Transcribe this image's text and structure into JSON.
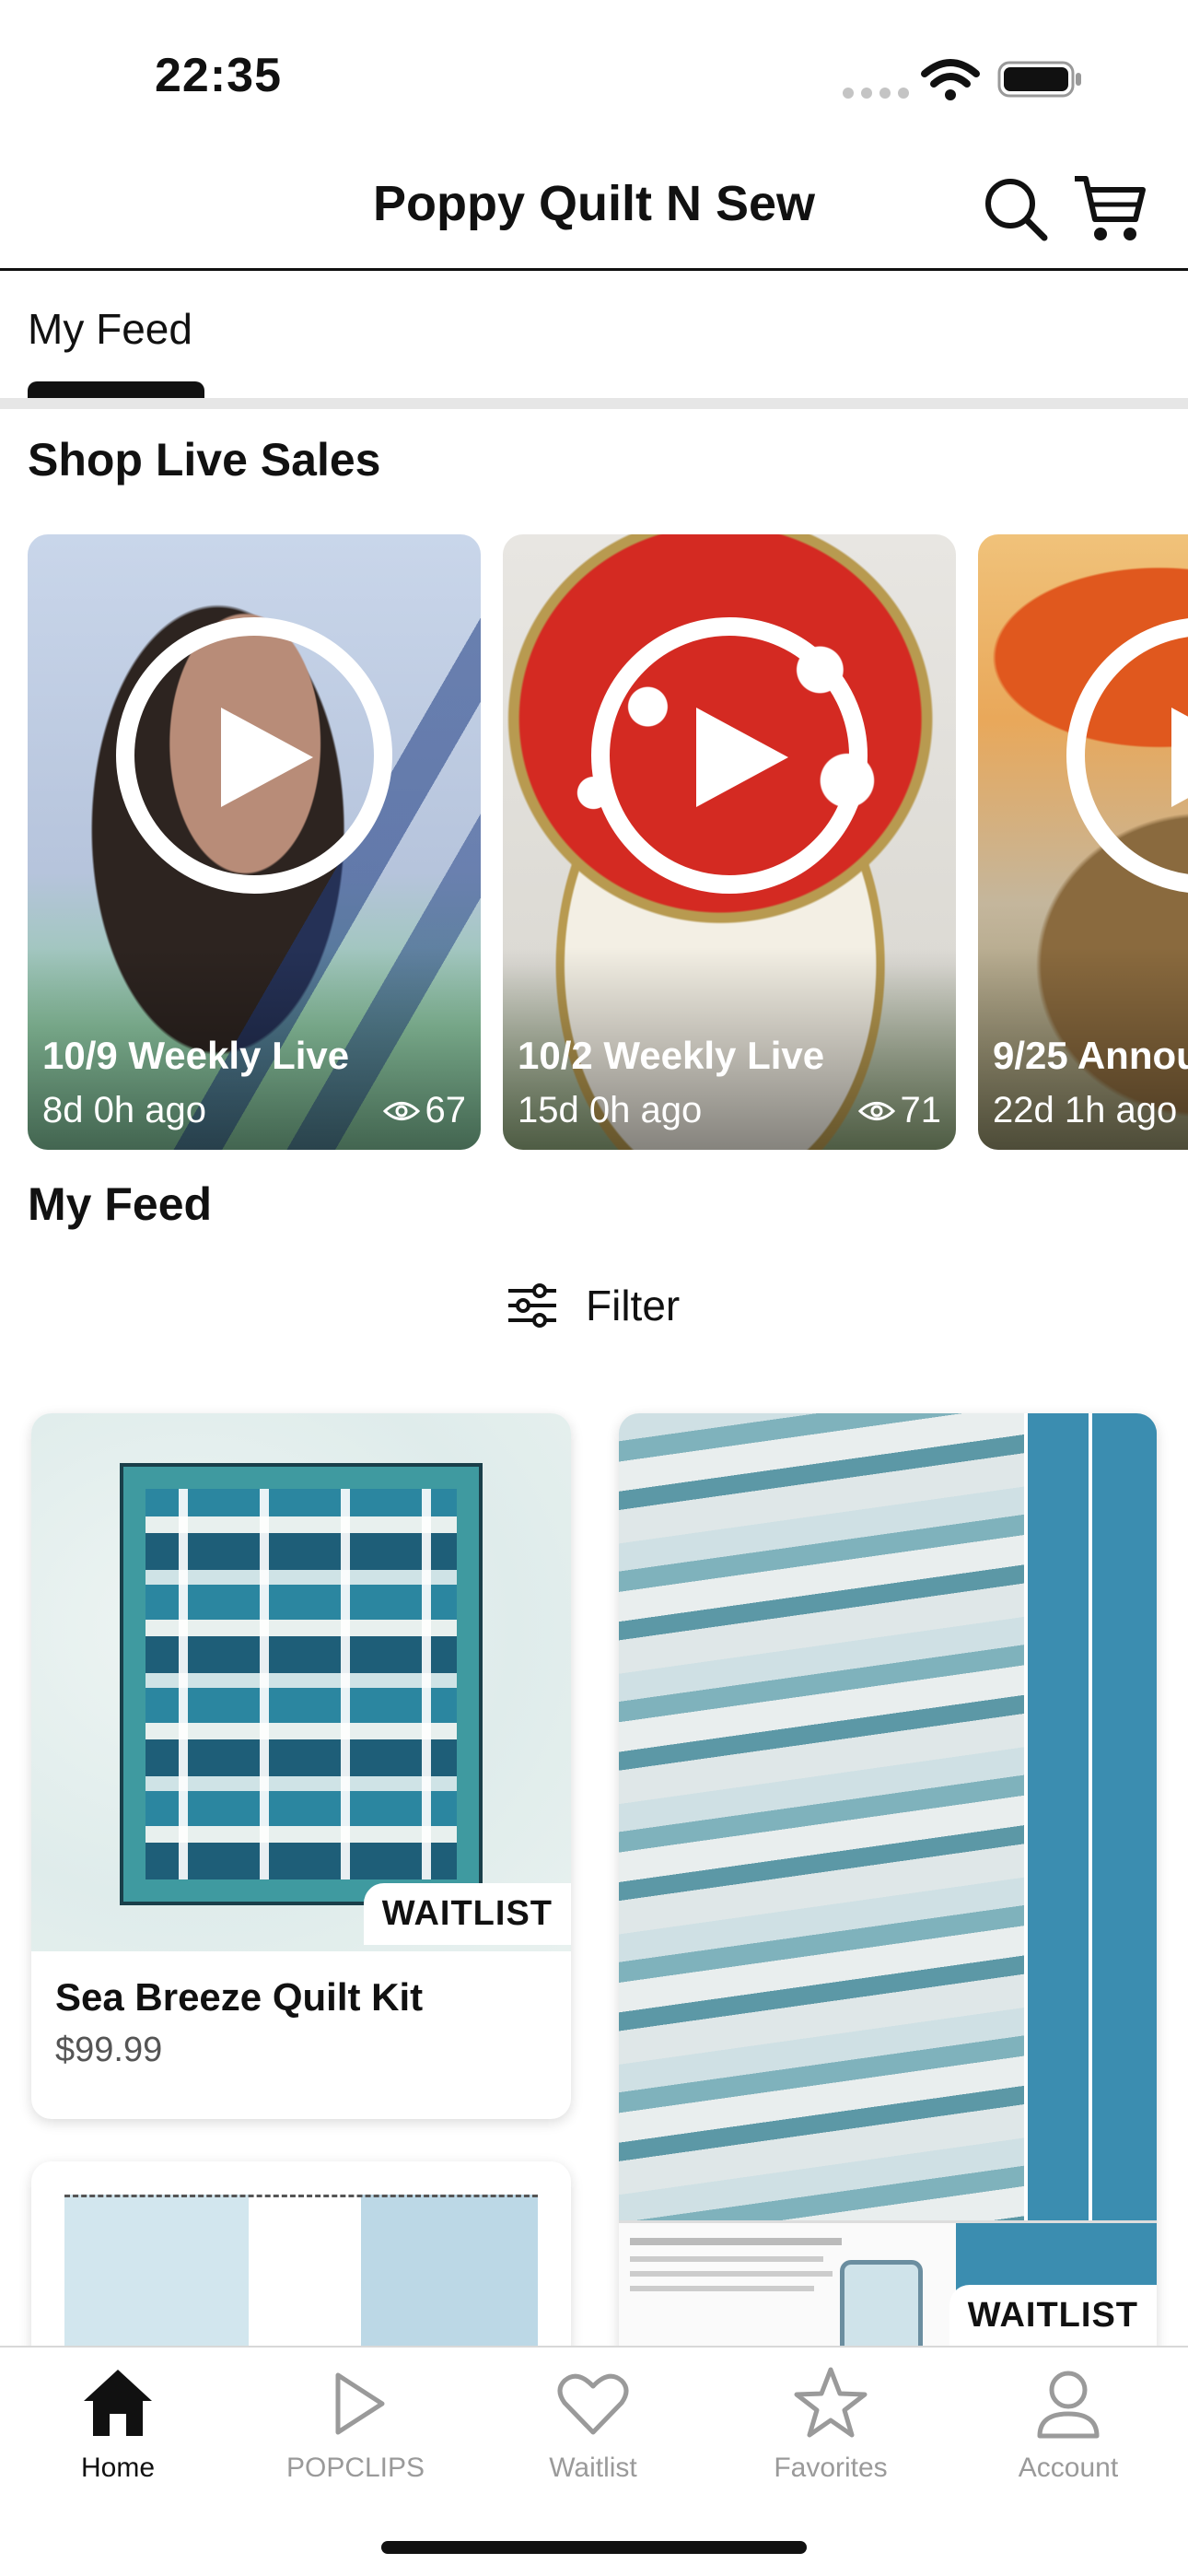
{
  "status_bar": {
    "time": "22:35"
  },
  "header": {
    "title": "Poppy Quilt N Sew"
  },
  "tabs": [
    {
      "label": "My Feed",
      "active": true
    }
  ],
  "live_section": {
    "title": "Shop Live Sales",
    "cards": [
      {
        "title": "10/9 Weekly Live",
        "age": "8d 0h ago",
        "views": "67"
      },
      {
        "title": "10/2 Weekly Live",
        "age": "15d 0h ago",
        "views": "71"
      },
      {
        "title": "9/25 Annou",
        "age": "22d 1h ago",
        "views": ""
      }
    ]
  },
  "feed_section": {
    "title": "My Feed",
    "filter_label": "Filter"
  },
  "products": [
    {
      "name": "Sea Breeze Quilt Kit",
      "price": "$99.99",
      "badge": "WAITLIST"
    },
    {
      "name": "",
      "price": "",
      "badge": "WAITLIST"
    }
  ],
  "bottom_nav": [
    {
      "label": "Home",
      "icon": "home-icon",
      "active": true
    },
    {
      "label": "POPCLIPS",
      "icon": "play-icon",
      "active": false
    },
    {
      "label": "Waitlist",
      "icon": "heart-icon",
      "active": false
    },
    {
      "label": "Favorites",
      "icon": "star-icon",
      "active": false
    },
    {
      "label": "Account",
      "icon": "person-icon",
      "active": false
    }
  ],
  "colors": {
    "accent": "#111111",
    "inactive": "#9a9a9a",
    "live_card_2_red": "#d42a22"
  }
}
